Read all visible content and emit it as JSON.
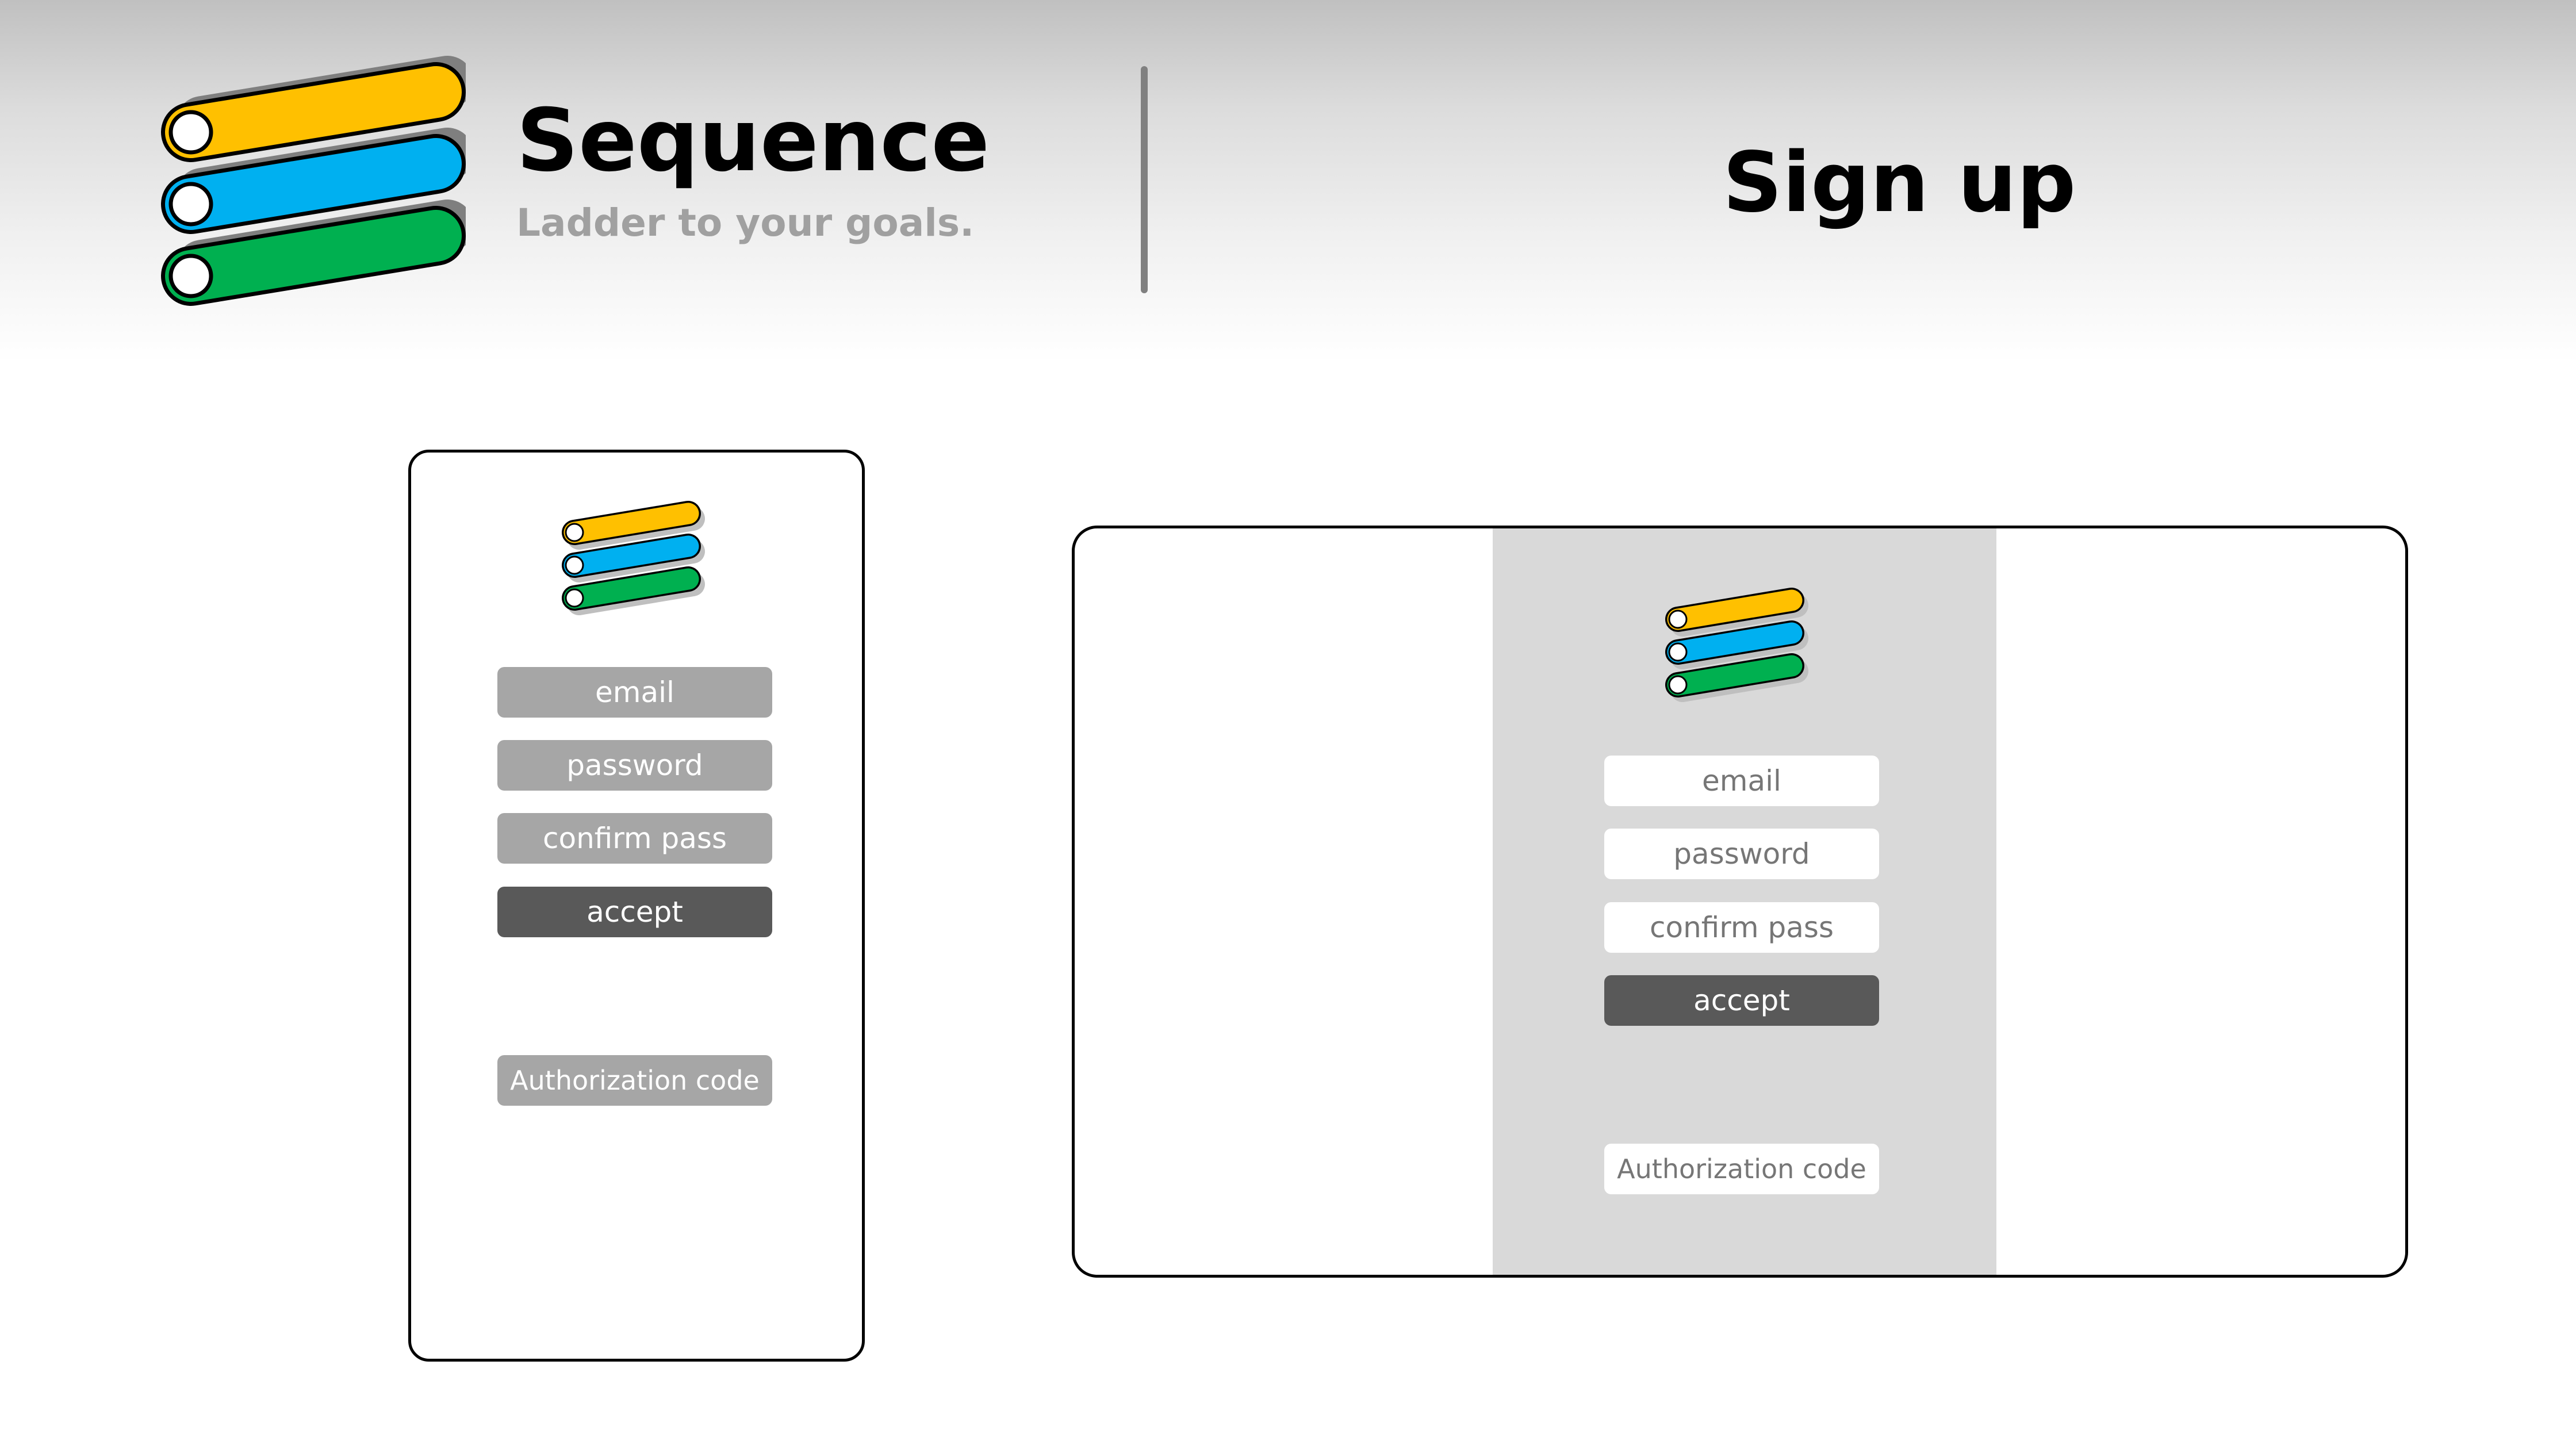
{
  "brand": {
    "name": "Sequence",
    "tagline": "Ladder to your goals."
  },
  "header": {
    "title": "Sign up"
  },
  "form": {
    "email_placeholder": "email",
    "password_placeholder": "password",
    "confirm_placeholder": "confirm pass",
    "accept_label": "accept",
    "auth_code_placeholder": "Authorization code"
  },
  "colors": {
    "logo_yellow": "#ffc000",
    "logo_blue": "#00b0f0",
    "logo_green": "#00b050",
    "input_grey": "#a6a6a6",
    "button_dark": "#595959",
    "panel_grey": "#d9d9d9"
  }
}
